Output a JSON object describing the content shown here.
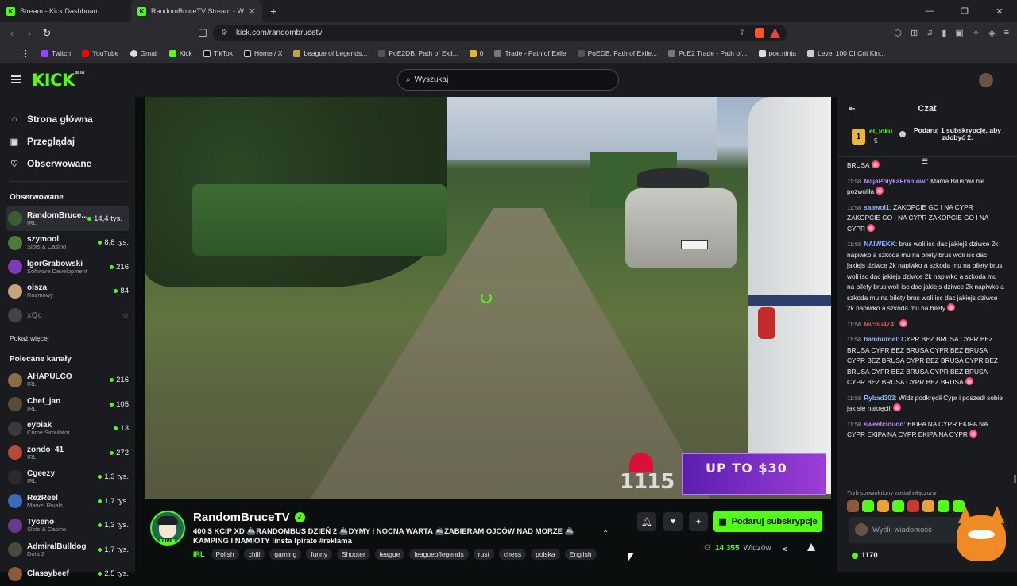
{
  "browser": {
    "tabs": [
      {
        "title": "Stream - Kick Dashboard",
        "active": false
      },
      {
        "title": "RandomBruceTV Stream - Wa",
        "active": true
      }
    ],
    "url": "kick.com/randombrucetv",
    "bookmarks": [
      "Twitch",
      "YouTube",
      "Gmail",
      "Kick",
      "TikTok",
      "Home / X",
      "League of Legends...",
      "PoE2DB, Path of Exil...",
      "0",
      "Trade - Path of Exile",
      "PoEDB, Path of Exile...",
      "PoE2 Trade - Path of...",
      "poe.ninja",
      "Level 100 CI Crit Kin..."
    ]
  },
  "header": {
    "logo": "KICK",
    "logo_sup": "BETA",
    "search_placeholder": "Wyszukaj"
  },
  "sidebar": {
    "nav": [
      {
        "label": "Strona główna",
        "icon": "home-icon"
      },
      {
        "label": "Przeglądaj",
        "icon": "browse-icon"
      },
      {
        "label": "Obserwowane",
        "icon": "heart-icon"
      }
    ],
    "followed_title": "Obserwowane",
    "followed": [
      {
        "name": "RandomBruce...",
        "category": "IRL",
        "viewers": "14,4 tys.",
        "color": "#3b5d33"
      },
      {
        "name": "szymool",
        "category": "Slots & Casino",
        "viewers": "8,8 tys.",
        "color": "#4b7b3a"
      },
      {
        "name": "IgorGrabowski",
        "category": "Software Development",
        "viewers": "216",
        "color": "#7b3ab8"
      },
      {
        "name": "olsza",
        "category": "Rozmowy",
        "viewers": "84",
        "color": "#c9a27e"
      },
      {
        "name": "xQc",
        "category": "",
        "viewers": "",
        "color": "#444"
      }
    ],
    "show_more": "Pokaż więcej",
    "recommended_title": "Polecane kanały",
    "recommended": [
      {
        "name": "AHAPULCO",
        "category": "IRL",
        "viewers": "216",
        "color": "#8a6b4a"
      },
      {
        "name": "Chef_jan",
        "category": "IRL",
        "viewers": "105",
        "color": "#5a4a3a"
      },
      {
        "name": "eybiak",
        "category": "Crime Simulator",
        "viewers": "13",
        "color": "#3a3a3a"
      },
      {
        "name": "zondo_41",
        "category": "IRL",
        "viewers": "272",
        "color": "#b84a3a"
      },
      {
        "name": "Cgeezy",
        "category": "IRL",
        "viewers": "1,3 tys.",
        "color": "#2a2a2a"
      },
      {
        "name": "RezReel",
        "category": "Marvel Rivals",
        "viewers": "1,7 tys.",
        "color": "#3a6ab8"
      },
      {
        "name": "Tyceno",
        "category": "Slots & Casino",
        "viewers": "1,3 tys.",
        "color": "#6a3a8a"
      },
      {
        "name": "AdmiralBulldog",
        "category": "Dota 2",
        "viewers": "1,7 tys.",
        "color": "#4a4a3a"
      },
      {
        "name": "Classybeef",
        "category": "",
        "viewers": "2,5 tys.",
        "color": "#8a5a3a"
      }
    ]
  },
  "video": {
    "counter": "1115",
    "ad_text": "UP TO $30"
  },
  "stream": {
    "name": "RandomBruceTV",
    "live": "LIVE",
    "title": "400 $ KCIP XD 🚢RANDOMBUS DZIEŃ 2 🚢DYMY I NOCNA WARTA 🚢ZABIERAM OJCÓW NAD MORZE 🚢 KAMPING I NAMIOTY !insta !pirate #reklama",
    "category": "IRL",
    "tags": [
      "Polish",
      "chill",
      "gaming",
      "funny",
      "Shooter",
      "league",
      "leagueoflegends",
      "rust",
      "chess",
      "polska",
      "English"
    ],
    "subscribe_label": "Podaruj subskrypcje",
    "viewers_count": "14 355",
    "viewers_label": "Widzów"
  },
  "chat": {
    "title": "Czat",
    "pinned": {
      "rank": "1",
      "user": "el_loku",
      "count": "5",
      "text": "Podaruj 1 subskrypcję, aby zdobyć 2."
    },
    "messages": [
      {
        "time": "",
        "user": "",
        "color": "#eee",
        "text": "BRUSA"
      },
      {
        "time": "11:58",
        "user": "MajaPolykaFraniowi",
        "color": "#b98cff",
        "text": "Mama Brusowi nie pozwoliła"
      },
      {
        "time": "11:58",
        "user": "saawol1",
        "color": "#8cb4ff",
        "text": "ZAKOPCIE GO I NA CYPR ZAKOPCIE GO I NA CYPR ZAKOPCIE GO I NA CYPR"
      },
      {
        "time": "11:58",
        "user": "NAIWEKK",
        "color": "#8cb4ff",
        "text": "brus woli isc dac jakiejś dziwce 2k napiwko a szkoda mu na bilety brus woli isc dac jakiejs dziwce 2k napiwko a szkoda mu na bilety brus woli isc dac jakiejs dziwce 2k napiwko a szkoda mu na bilety brus woli isc dac jakiejs dziwce 2k napiwko a szkoda mu na bilety brus woli isc dac jakiejs dziwce 2k napiwko a szkoda mu na bilety"
      },
      {
        "time": "11:58",
        "user": "Michu474",
        "color": "#e05555",
        "text": ""
      },
      {
        "time": "11:58",
        "user": "hamburdel",
        "color": "#8cb4ff",
        "text": "CYPR BEZ BRUSA CYPR BEZ BRUSA CYPR BEZ BRUSA CYPR BEZ BRUSA CYPR BEZ BRUSA CYPR BEZ BRUSA CYPR BEZ BRUSA CYPR BEZ BRUSA CYPR BEZ BRUSA CYPR BEZ BRUSA CYPR BEZ BRUSA"
      },
      {
        "time": "11:58",
        "user": "Rybad303",
        "color": "#8cb4ff",
        "text": "Widz podkręcił Cypr i poszedł sobie jak się nakręcili"
      },
      {
        "time": "11:58",
        "user": "sweetcloudd",
        "color": "#b98cff",
        "text": "EKIPA NA CYPR EKIPA NA CYPR EKIPA NA CYPR EKIPA NA CYPR"
      }
    ],
    "slow_mode": "Tryb spowolniony został włączony",
    "input_placeholder": "Wyślij wiadomość",
    "points": "1170"
  }
}
